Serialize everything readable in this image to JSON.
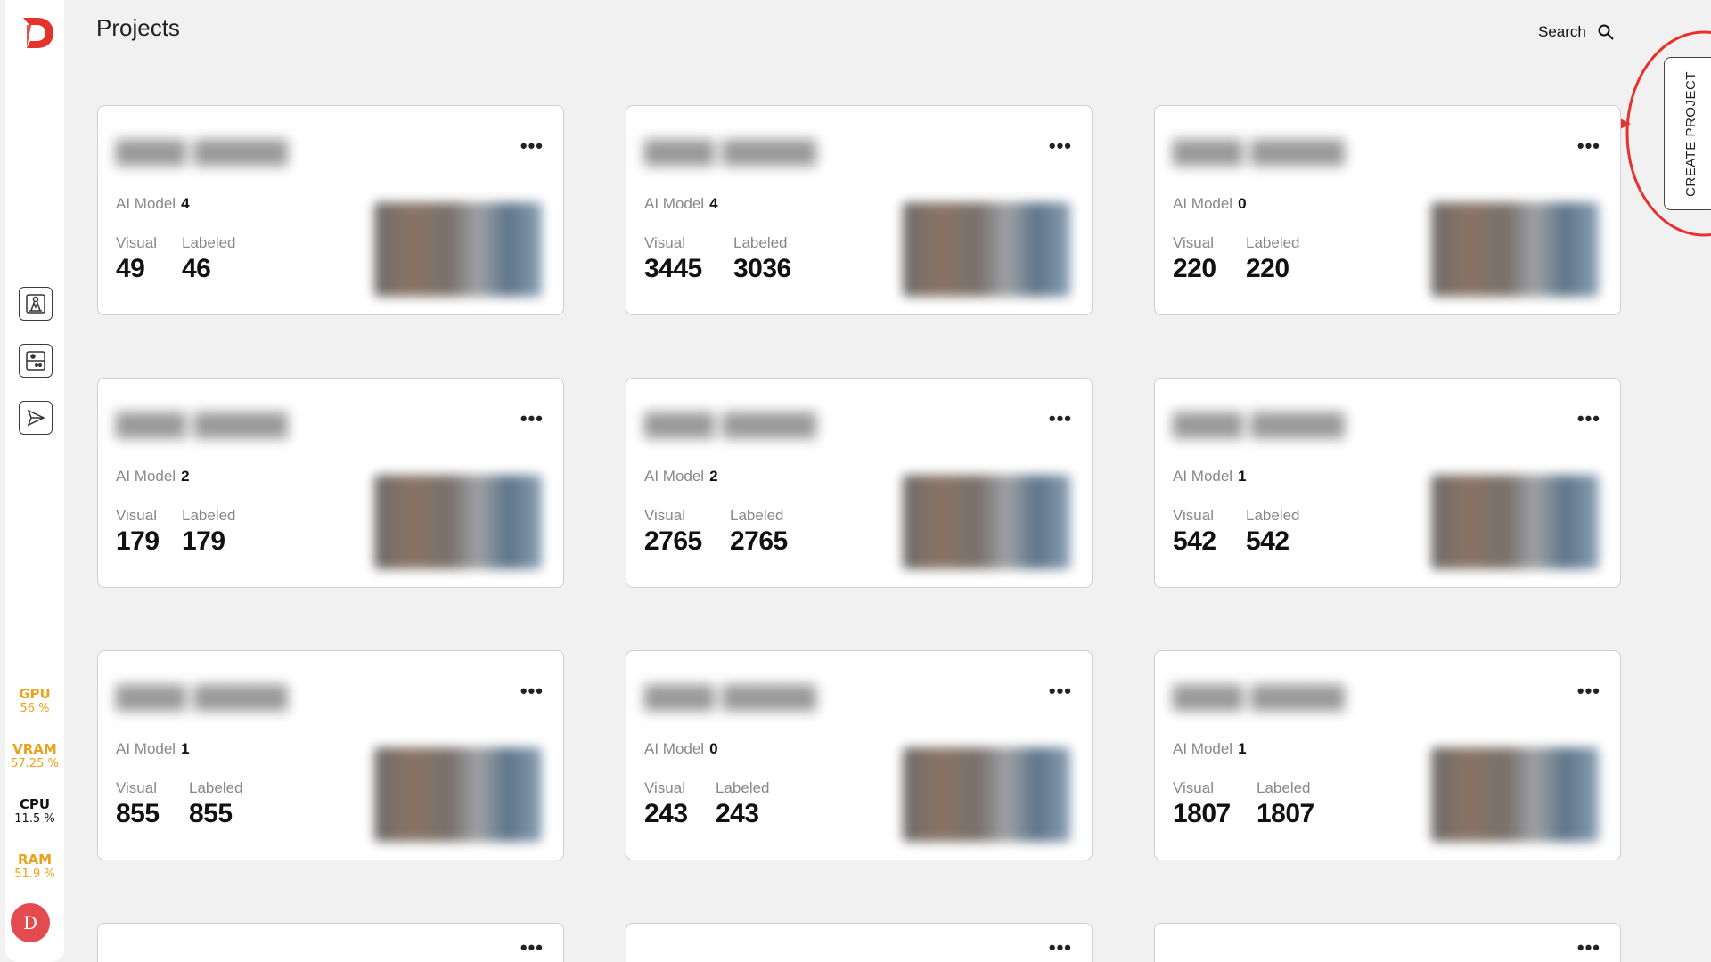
{
  "header": {
    "title": "Projects",
    "search_label": "Search"
  },
  "create_button": {
    "label": "CREATE PROJECT"
  },
  "sidebar": {
    "logo": "D",
    "nav": [
      {
        "icon": "person-image-icon"
      },
      {
        "icon": "server-icon"
      },
      {
        "icon": "send-icon"
      }
    ],
    "metrics": [
      {
        "label": "GPU",
        "value": "56 %"
      },
      {
        "label": "VRAM",
        "value": "57.25 %"
      },
      {
        "label": "CPU",
        "value": "11.5 %"
      },
      {
        "label": "RAM",
        "value": "51.9 %"
      }
    ],
    "avatar": "D"
  },
  "card_labels": {
    "ai_model": "AI Model",
    "visual": "Visual",
    "labeled": "Labeled"
  },
  "projects": [
    {
      "ai_model": "4",
      "visual": "49",
      "labeled": "46"
    },
    {
      "ai_model": "4",
      "visual": "3445",
      "labeled": "3036"
    },
    {
      "ai_model": "0",
      "visual": "220",
      "labeled": "220"
    },
    {
      "ai_model": "2",
      "visual": "179",
      "labeled": "179"
    },
    {
      "ai_model": "2",
      "visual": "2765",
      "labeled": "2765"
    },
    {
      "ai_model": "1",
      "visual": "542",
      "labeled": "542"
    },
    {
      "ai_model": "1",
      "visual": "855",
      "labeled": "855"
    },
    {
      "ai_model": "0",
      "visual": "243",
      "labeled": "243"
    },
    {
      "ai_model": "1",
      "visual": "1807",
      "labeled": "1807"
    }
  ],
  "colors": {
    "accent_red": "#e5322d",
    "metric_warn": "#e9a21c",
    "avatar_bg": "#e34b4f"
  }
}
